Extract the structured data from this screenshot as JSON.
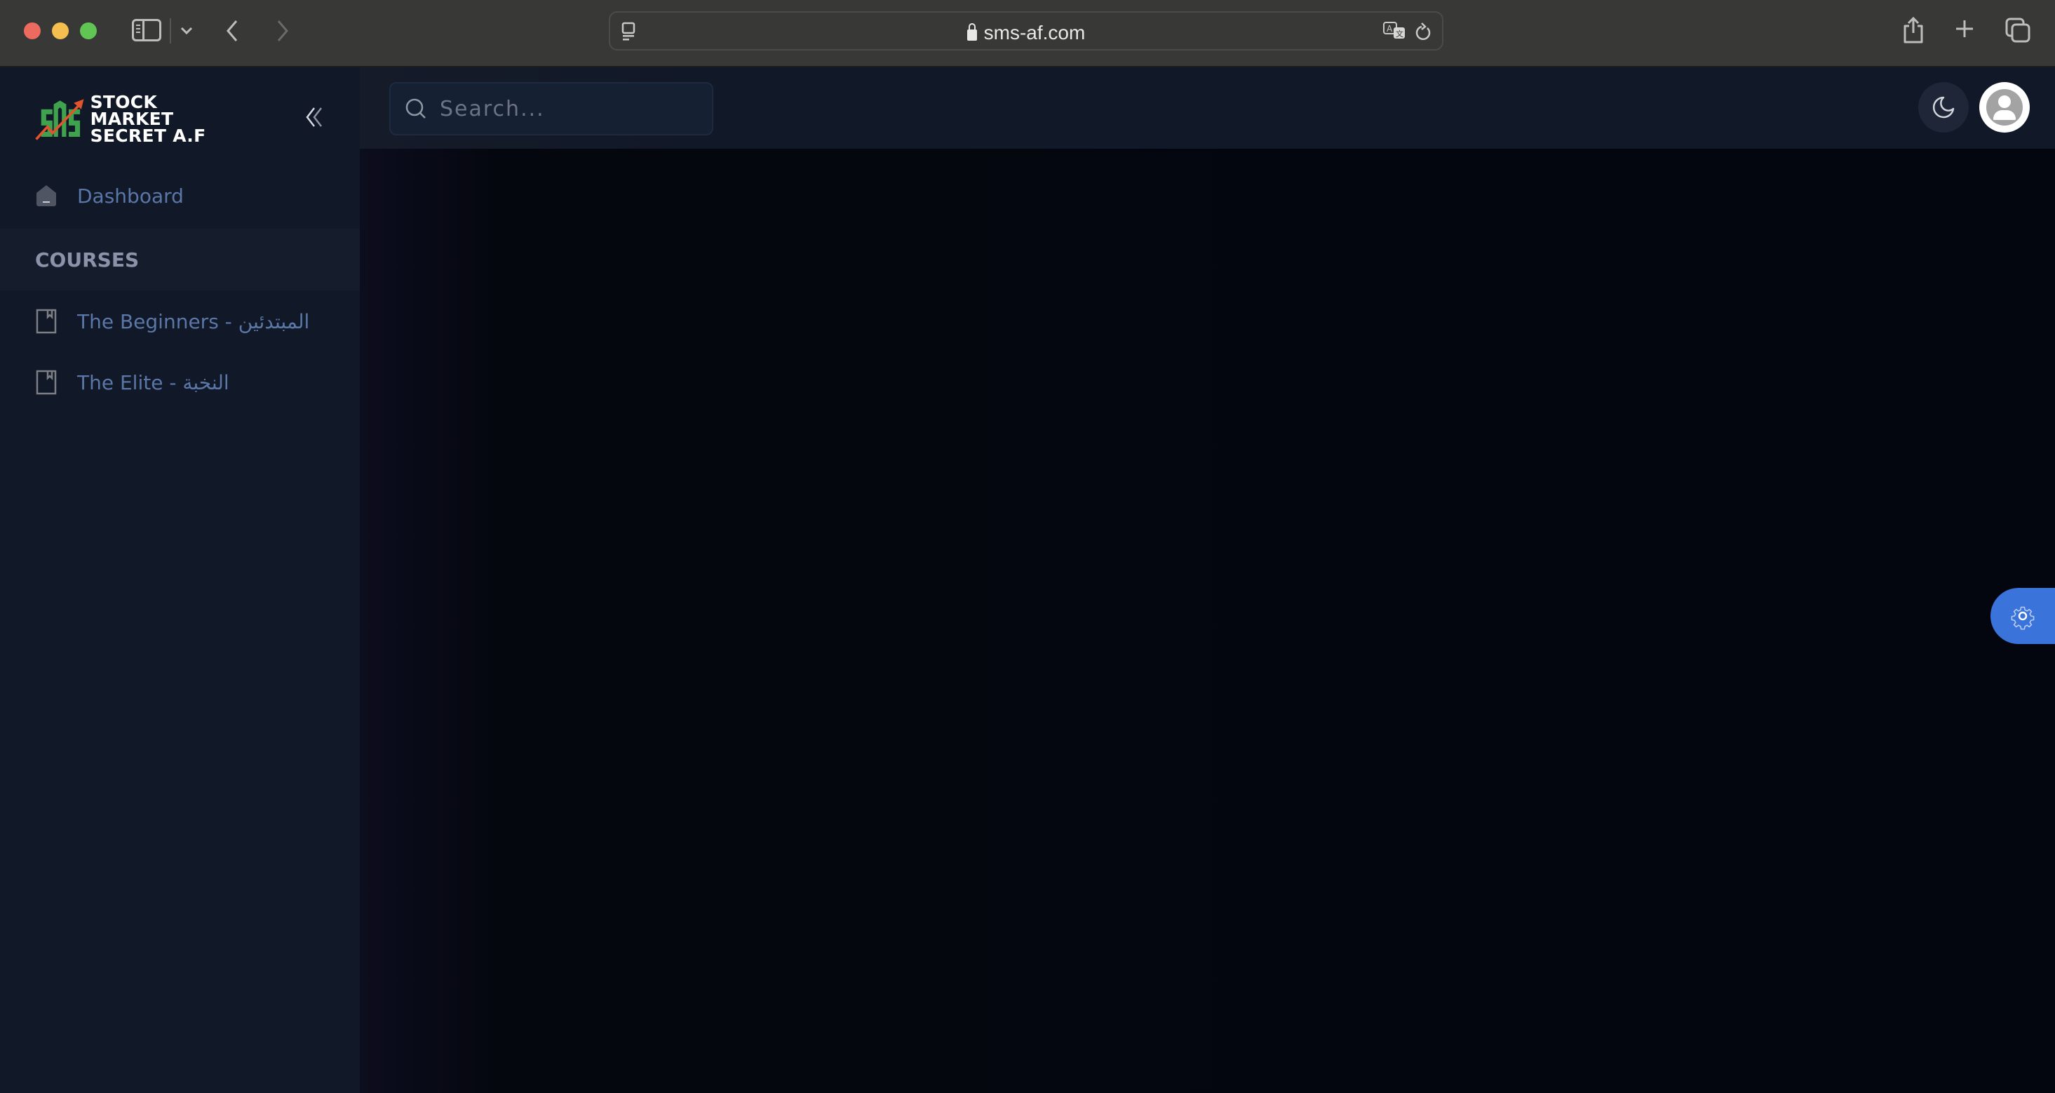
{
  "browser": {
    "url": "sms-af.com",
    "icons": [
      "sidebar-toggle-icon",
      "chevron-down-icon",
      "back-icon",
      "forward-icon",
      "reader-icon",
      "lock-icon",
      "translate-icon",
      "reload-icon",
      "share-icon",
      "new-tab-icon",
      "tabs-overview-icon"
    ]
  },
  "sidebar": {
    "brand": {
      "line1": "STOCK MARKET",
      "line2": "SECRET A.F",
      "mark": "SMS",
      "colors": {
        "green": "#3fa34d",
        "red": "#e2532e"
      }
    },
    "collapse_label": "«",
    "dashboard": {
      "label": "Dashboard",
      "icon": "home-icon"
    },
    "section_title": "COURSES",
    "courses": [
      {
        "label": "The Beginners - المبتدئين",
        "icon": "book-icon"
      },
      {
        "label": "The Elite - النخبة",
        "icon": "book-icon"
      }
    ]
  },
  "header": {
    "search": {
      "placeholder": "Search...",
      "value": ""
    },
    "theme_toggle_icon": "moon-icon",
    "avatar_icon": "user-icon"
  },
  "settings_tab": {
    "icon": "gear-icon",
    "color": "#3a74db"
  }
}
